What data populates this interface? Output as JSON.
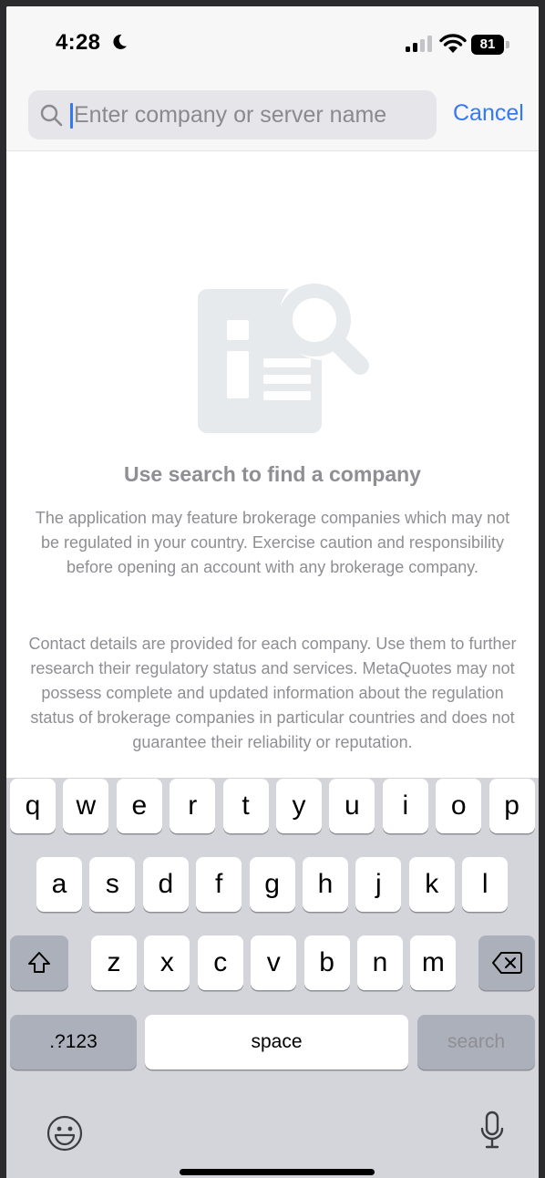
{
  "status_bar": {
    "time": "4:28",
    "battery": "81",
    "icons": [
      "moon-icon",
      "cellular-signal-icon",
      "wifi-icon",
      "battery-icon"
    ]
  },
  "search": {
    "placeholder": "Enter company or server name",
    "value": "",
    "cancel_label": "Cancel"
  },
  "empty_state": {
    "icon": "document-search-icon",
    "title": "Use search to find a company",
    "paragraph1": "The application may feature brokerage companies which may not be regulated in your country. Exercise caution and responsibility before opening an account with any brokerage company.",
    "paragraph2": "Contact details are provided for each company. Use them to further research their regulatory status and services. MetaQuotes may not possess complete and updated information about the regulation status of brokerage companies in particular countries and does not guarantee their reliability or reputation."
  },
  "keyboard": {
    "row1": [
      "q",
      "w",
      "e",
      "r",
      "t",
      "y",
      "u",
      "i",
      "o",
      "p"
    ],
    "row2": [
      "a",
      "s",
      "d",
      "f",
      "g",
      "h",
      "j",
      "k",
      "l"
    ],
    "row3": [
      "z",
      "x",
      "c",
      "v",
      "b",
      "n",
      "m"
    ],
    "numbers_label": ".?123",
    "space_label": "space",
    "search_label": "search",
    "icons": [
      "shift-icon",
      "backspace-icon",
      "emoji-icon",
      "microphone-icon"
    ]
  },
  "colors": {
    "accent": "#3478f6",
    "secondary_text": "#8e8e93",
    "keyboard_bg": "#d3d5db",
    "illustration": "#e6eaec"
  }
}
